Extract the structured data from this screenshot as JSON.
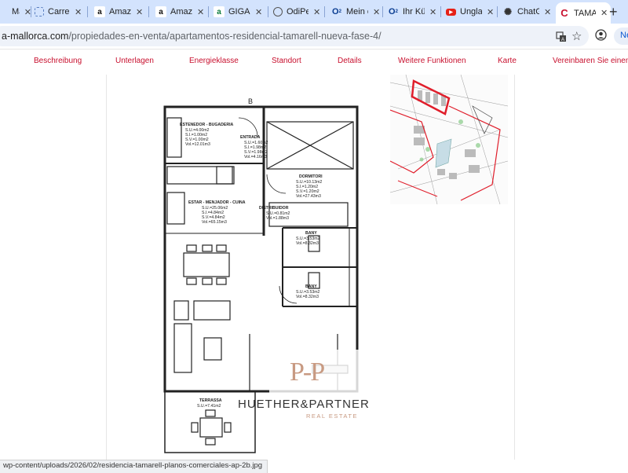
{
  "tabs": [
    {
      "label": "Mail",
      "favicon": "envelope-icon",
      "active": false
    },
    {
      "label": "Carrer",
      "favicon": "loading-icon",
      "active": false
    },
    {
      "label": "Amazon",
      "favicon": "amazon-icon",
      "active": false
    },
    {
      "label": "Amazon",
      "favicon": "amazon-icon",
      "active": false
    },
    {
      "label": "GIGAL",
      "favicon": "gigal-icon",
      "active": false
    },
    {
      "label": "OdiPe",
      "favicon": "globe-icon",
      "active": false
    },
    {
      "label": "Mein o",
      "favicon": "o2-icon",
      "active": false
    },
    {
      "label": "Ihr Kü",
      "favicon": "o2-icon",
      "active": false
    },
    {
      "label": "Unglau",
      "favicon": "youtube-icon",
      "active": false
    },
    {
      "label": "ChatG",
      "favicon": "chatgpt-icon",
      "active": false
    },
    {
      "label": "TAMA",
      "favicon": "c-icon",
      "active": true
    }
  ],
  "address_bar": {
    "host": "a-mallorca.com",
    "path": "/propiedades-en-venta/apartamentos-residencial-tamarell-nueva-fase-4/",
    "right_text": "Neu"
  },
  "site_nav": [
    "Beschreibung",
    "Unterlagen",
    "Energieklasse",
    "Standort",
    "Details",
    "Weitere Funktionen",
    "Karte",
    "Vereinbaren Sie einen B"
  ],
  "floorplan": {
    "block_letter": "B",
    "rooms": [
      {
        "name": "ESTENEDOR - BUGADERIA",
        "lines": [
          "S.U.=4.00m2",
          "S.I.=1.00m2",
          "S.V.=1.00m2",
          "Vol.=12.01m3"
        ]
      },
      {
        "name": "ENTRADA",
        "lines": [
          "S.U.=1.60m2",
          "S.I.=1.98m2",
          "S.V.=1.98m2",
          "Vol.=4.16m3"
        ]
      },
      {
        "name": "DORMITORI",
        "lines": [
          "S.U.=10.13m2",
          "S.I.=1.20m2",
          "S.V.=1.20m2",
          "Vol.=27.43m3"
        ]
      },
      {
        "name": "ESTAR - MENJADOR - CUINA",
        "lines": [
          "S.U.=25.06m2",
          "S.I.=4.84m2",
          "S.V.=4.84m2",
          "Vol.=65.15m3"
        ]
      },
      {
        "name": "DISTRIBUIDOR",
        "lines": [
          "S.U.=0.81m2",
          "Vol.=1.88m3"
        ]
      },
      {
        "name": "BANY",
        "lines": [
          "S.U.=3.53m2",
          "Vol.=8.32m3"
        ]
      },
      {
        "name": "BANY",
        "lines": [
          "S.U.=3.53m2",
          "Vol.=8.32m3"
        ]
      },
      {
        "name": "TERRASSA",
        "lines": [
          "S.U.=7.41m2"
        ]
      }
    ]
  },
  "watermark": {
    "brand": "HUETHER&PARTNER",
    "sub": "REAL ESTATE"
  },
  "status_url": "wp-content/uploads/2026/02/residencia-tamarell-planos-comerciales-ap-2b.jpg",
  "colors": {
    "accent": "#c8102e",
    "tabbar": "#d3e3fd",
    "watermark": "#c89a82"
  }
}
